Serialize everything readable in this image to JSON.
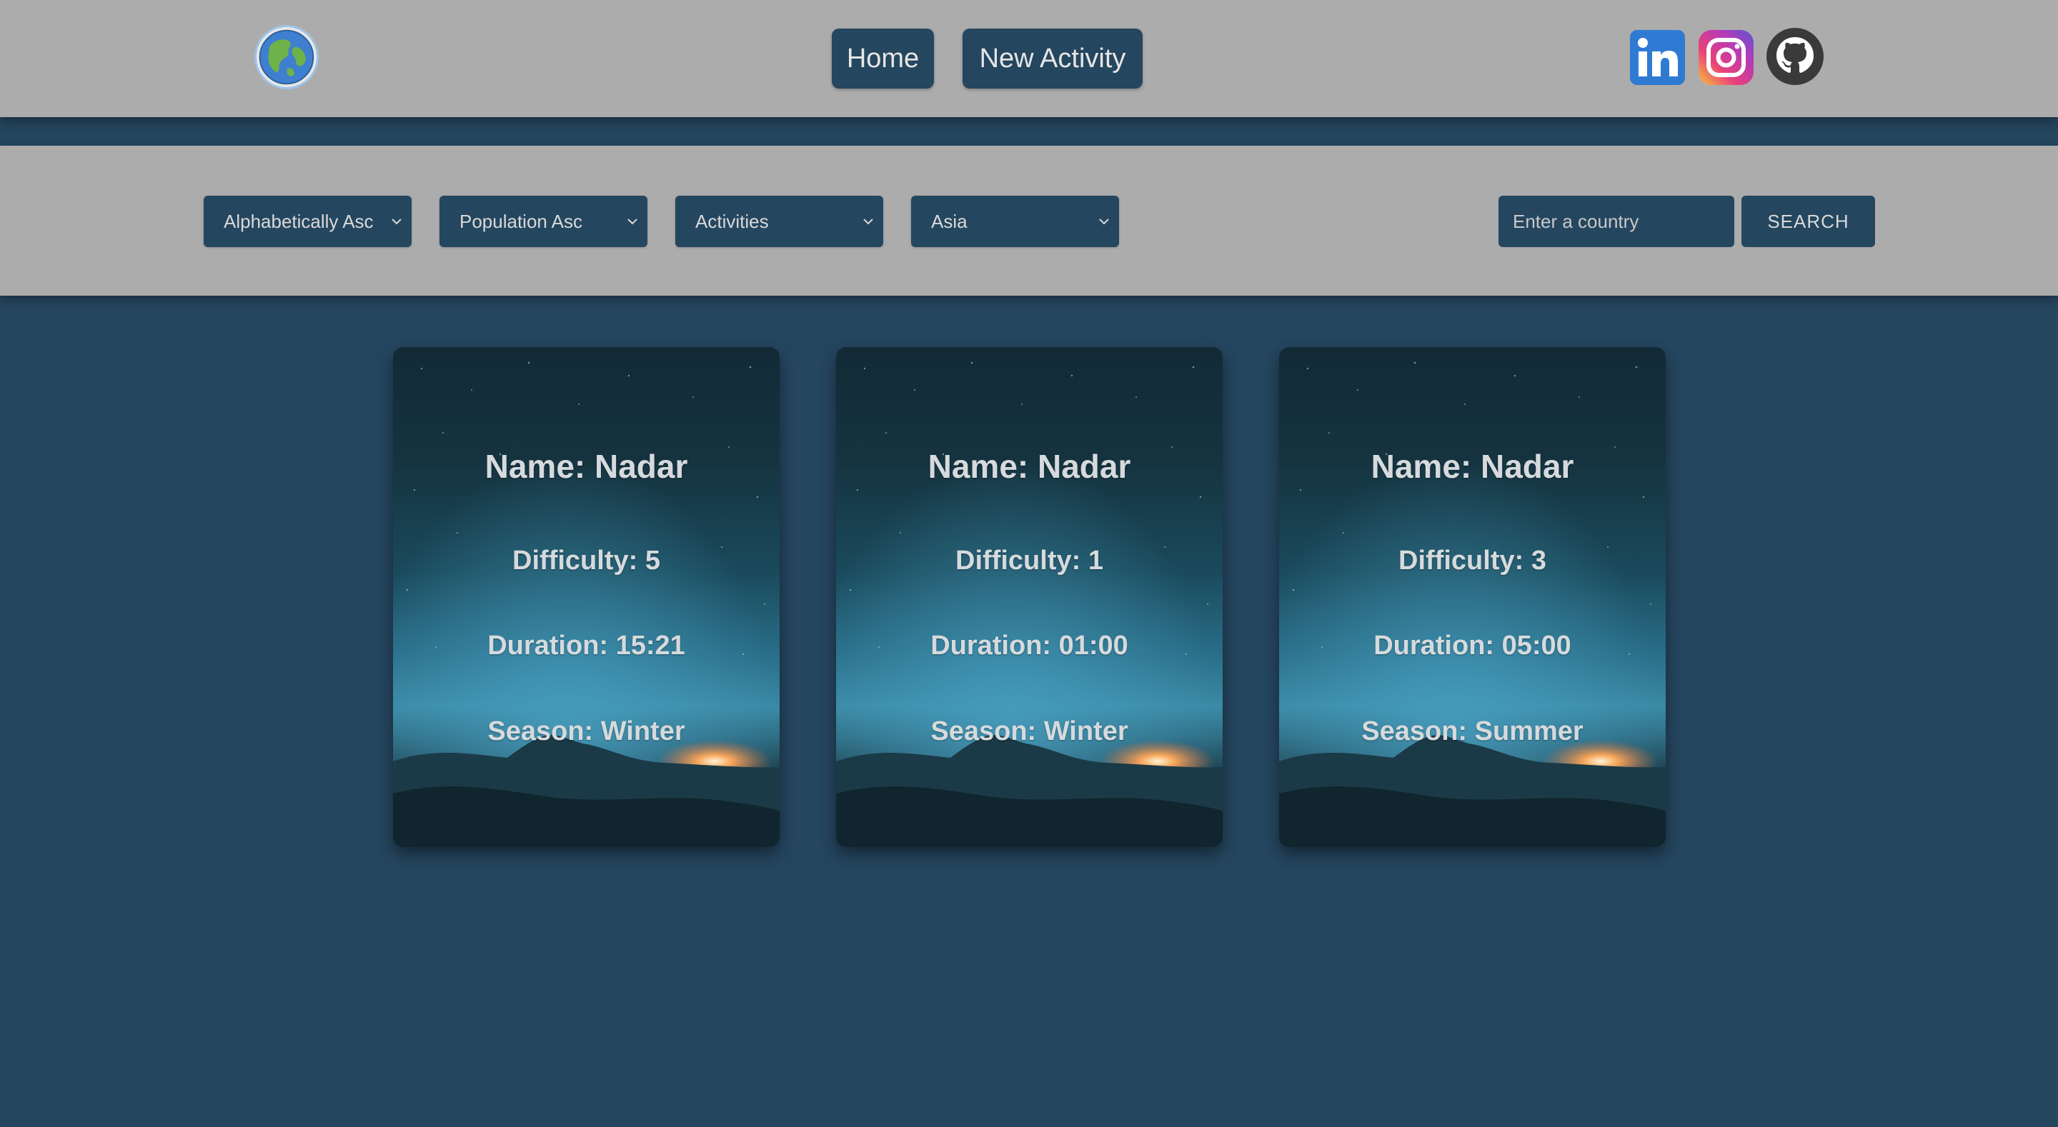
{
  "header": {
    "logo_icon": "globe-logo-icon",
    "nav": [
      {
        "label": "Home"
      },
      {
        "label": "New Activity"
      }
    ],
    "social": [
      {
        "icon": "linkedin-icon"
      },
      {
        "icon": "instagram-icon"
      },
      {
        "icon": "github-icon"
      }
    ]
  },
  "filters": {
    "sort_name": {
      "selected": "Alphabetically Asc"
    },
    "sort_population": {
      "selected": "Population Asc"
    },
    "activity": {
      "selected": "Activities"
    },
    "continent": {
      "selected": "Asia"
    },
    "search": {
      "placeholder": "Enter a country",
      "value": ""
    },
    "search_button": "SEARCH"
  },
  "activities": [
    {
      "name": "Name: Nadar",
      "difficulty": "Difficulty: 5",
      "duration": "Duration: 15:21",
      "season": "Season: Winter"
    },
    {
      "name": "Name: Nadar",
      "difficulty": "Difficulty: 1",
      "duration": "Duration: 01:00",
      "season": "Season: Winter"
    },
    {
      "name": "Name: Nadar",
      "difficulty": "Difficulty: 3",
      "duration": "Duration: 05:00",
      "season": "Season: Summer"
    }
  ],
  "colors": {
    "bar_background": "#acacac",
    "page_background": "#25465f",
    "control_background": "#25465f",
    "card_text": "#d6dadd"
  }
}
